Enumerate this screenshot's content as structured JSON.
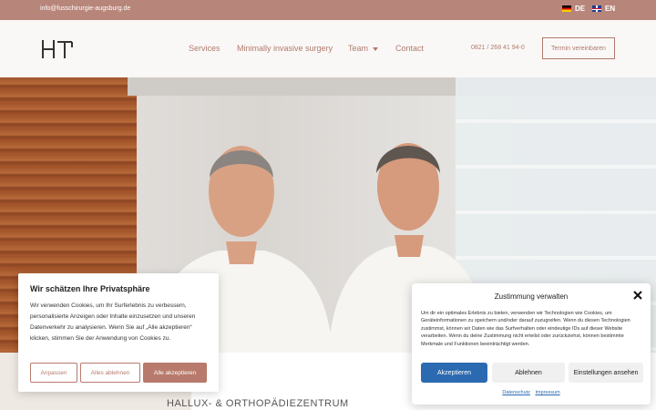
{
  "topbar": {
    "email": "info@fusschirurgie-augsburg.de",
    "languages": [
      {
        "code": "DE",
        "flag": "germany-flag-icon"
      },
      {
        "code": "EN",
        "flag": "uk-flag-icon"
      }
    ]
  },
  "header": {
    "logo_icon": "ht-logo-icon",
    "nav": {
      "services": "Services",
      "minimally_invasive": "Minimally invasive surgery",
      "team": "Team",
      "contact": "Contact"
    },
    "phone": "0821 / 268 41 94-0",
    "cta": "Termin vereinbaren"
  },
  "lower": {
    "title": "HALLUX- & ORTHOPÄDIEZENTRUM"
  },
  "cookie_left": {
    "title": "Wir schätzen Ihre Privatsphäre",
    "text": "Wir verwenden Cookies, um Ihr Surferlebnis zu verbessern, personalisierte Anzeigen oder Inhalte einzusetzen und unseren Datenverkehr zu analysieren. Wenn Sie auf „Alle akzeptieren“ klicken, stimmen Sie der Anwendung von Cookies zu.",
    "customize": "Anpassen",
    "reject_all": "Alles ablehnen",
    "accept_all": "Alle akzeptieren"
  },
  "cookie_right": {
    "title": "Zustimmung verwalten",
    "text": "Um dir ein optimales Erlebnis zu bieten, verwenden wir Technologien wie Cookies, um Geräteinformationen zu speichern und/oder darauf zuzugreifen. Wenn du diesen Technologien zustimmst, können wir Daten wie das Surfverhalten oder eindeutige IDs auf dieser Website verarbeiten. Wenn du deine Zustimmung nicht erteilst oder zurückziehst, können bestimmte Merkmale und Funktionen beeinträchtigt werden.",
    "accept": "Akzeptieren",
    "reject": "Ablehnen",
    "settings": "Einstellungen ansehen",
    "link_privacy": "Datenschutz",
    "link_imprint": "Impressum"
  },
  "colors": {
    "brand": "#b8857a",
    "accent_text": "#b07a6d",
    "accept_blue": "#2b6ab0"
  }
}
